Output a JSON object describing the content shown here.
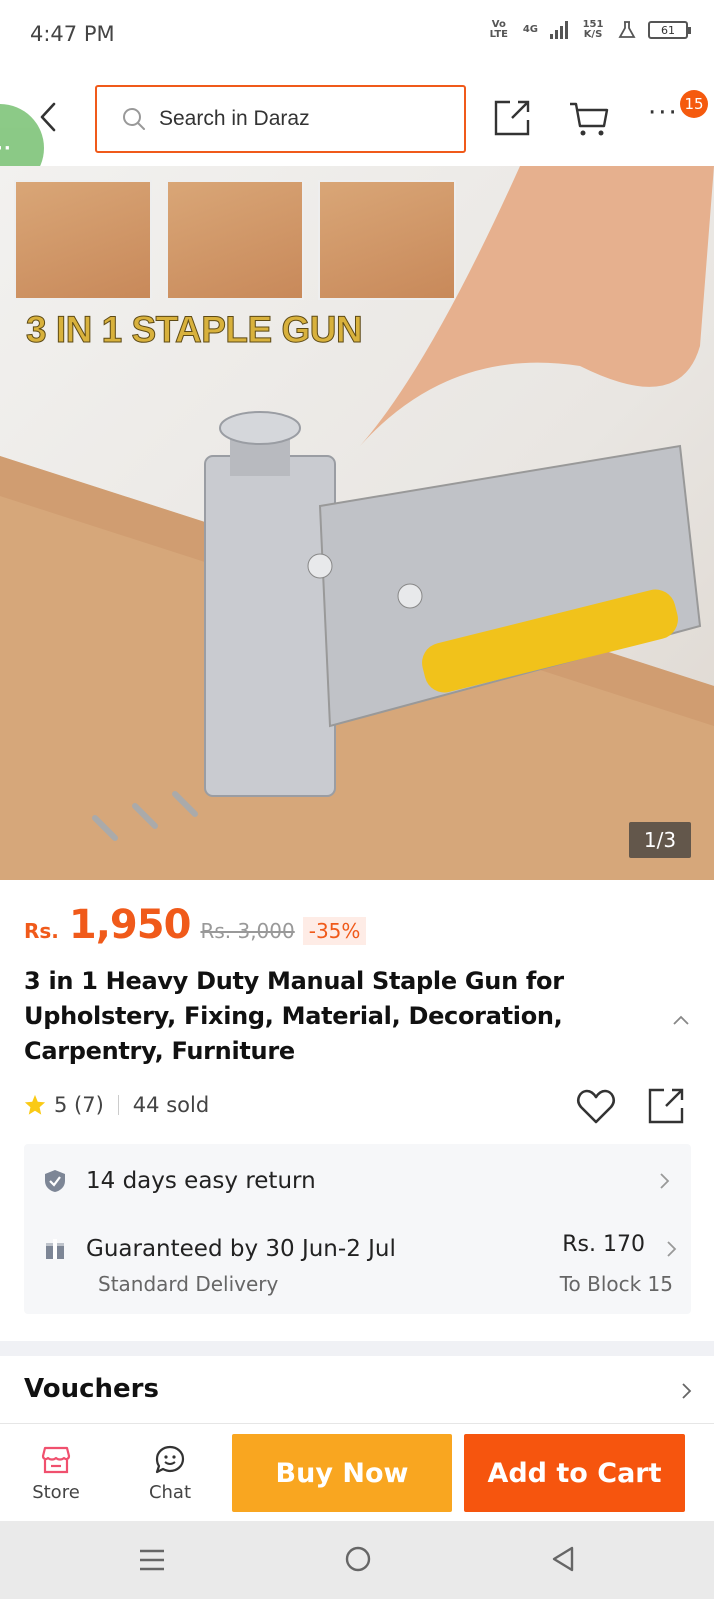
{
  "status_bar": {
    "time": "4:47 PM",
    "network_type": "Vo LTE",
    "signal": "4G",
    "data_rate": "151 K/S",
    "battery": "61"
  },
  "top_bar": {
    "search_placeholder": "Search in Daraz",
    "cart_count": "15"
  },
  "product_image": {
    "overlay_title": "3 IN 1 STAPLE GUN",
    "page_indicator": "1/3"
  },
  "product": {
    "currency": "Rs.",
    "price": "1,950",
    "original_price": "Rs. 3,000",
    "discount": "-35%",
    "title": "3 in 1 Heavy Duty Manual Staple Gun for Upholstery, Fixing, Material, Decoration, Carpentry, Furniture",
    "rating": "5 (7)",
    "sold": "44 sold"
  },
  "services": {
    "return_text": "14 days easy return",
    "delivery_text": "Guaranteed by 30 Jun-2 Jul",
    "delivery_type": "Standard Delivery",
    "delivery_price": "Rs. 170",
    "delivery_destination": "To Block 15"
  },
  "vouchers": {
    "title": "Vouchers"
  },
  "action_bar": {
    "store_label": "Store",
    "chat_label": "Chat",
    "buy_now_label": "Buy Now",
    "add_to_cart_label": "Add to Cart"
  },
  "colors": {
    "brand_orange": "#f05a1a",
    "buy_now": "#f9a620",
    "add_to_cart": "#f6550e"
  }
}
